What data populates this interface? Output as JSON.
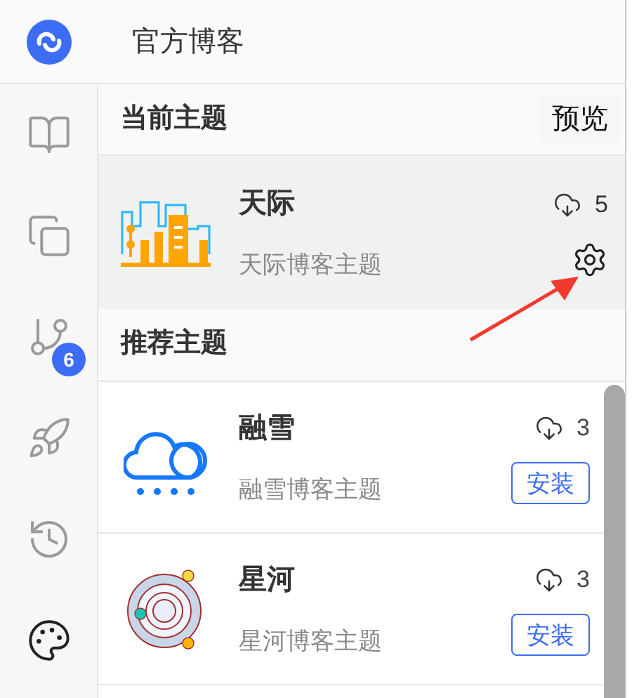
{
  "header": {
    "title": "官方博客"
  },
  "sidebar": {
    "items": [
      {
        "selected": false
      },
      {
        "selected": false
      },
      {
        "selected": false,
        "badge": "6"
      },
      {
        "selected": false
      },
      {
        "selected": false
      },
      {
        "selected": true
      }
    ]
  },
  "current_theme": {
    "heading": "当前主题",
    "preview_button": "预览",
    "theme": {
      "name": "天际",
      "description": "天际博客主题",
      "downloads": "5"
    }
  },
  "recommended": {
    "heading": "推荐主题",
    "themes": [
      {
        "name": "融雪",
        "description": "融雪博客主题",
        "downloads": "3",
        "button": "安装"
      },
      {
        "name": "星河",
        "description": "星河博客主题",
        "downloads": "3",
        "button": "安装"
      }
    ]
  }
}
